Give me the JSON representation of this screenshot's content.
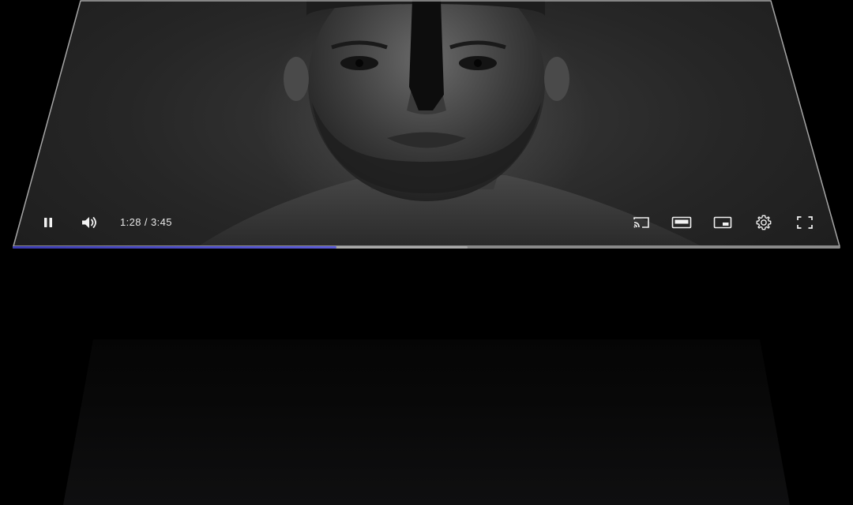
{
  "player": {
    "time": {
      "current": "1:28",
      "separator": " / ",
      "duration": "3:45"
    },
    "progress": {
      "played_fraction": 0.3911,
      "buffered_fraction": 0.55,
      "played_color": "#5b5bd6",
      "buffer_color": "#a9a9a9"
    },
    "controls": {
      "left": [
        {
          "name": "pause-icon",
          "action": "pause"
        },
        {
          "name": "volume-icon",
          "action": "volume"
        }
      ],
      "right": [
        {
          "name": "cast-icon",
          "action": "cast"
        },
        {
          "name": "theater-mode-icon",
          "action": "theater-mode"
        },
        {
          "name": "miniplayer-icon",
          "action": "miniplayer"
        },
        {
          "name": "settings-gear-icon",
          "action": "settings"
        },
        {
          "name": "fullscreen-icon",
          "action": "fullscreen"
        }
      ]
    },
    "colors": {
      "background": "#000000",
      "frame_border": "#c8c8c8",
      "icon": "#f2f2f2"
    }
  }
}
